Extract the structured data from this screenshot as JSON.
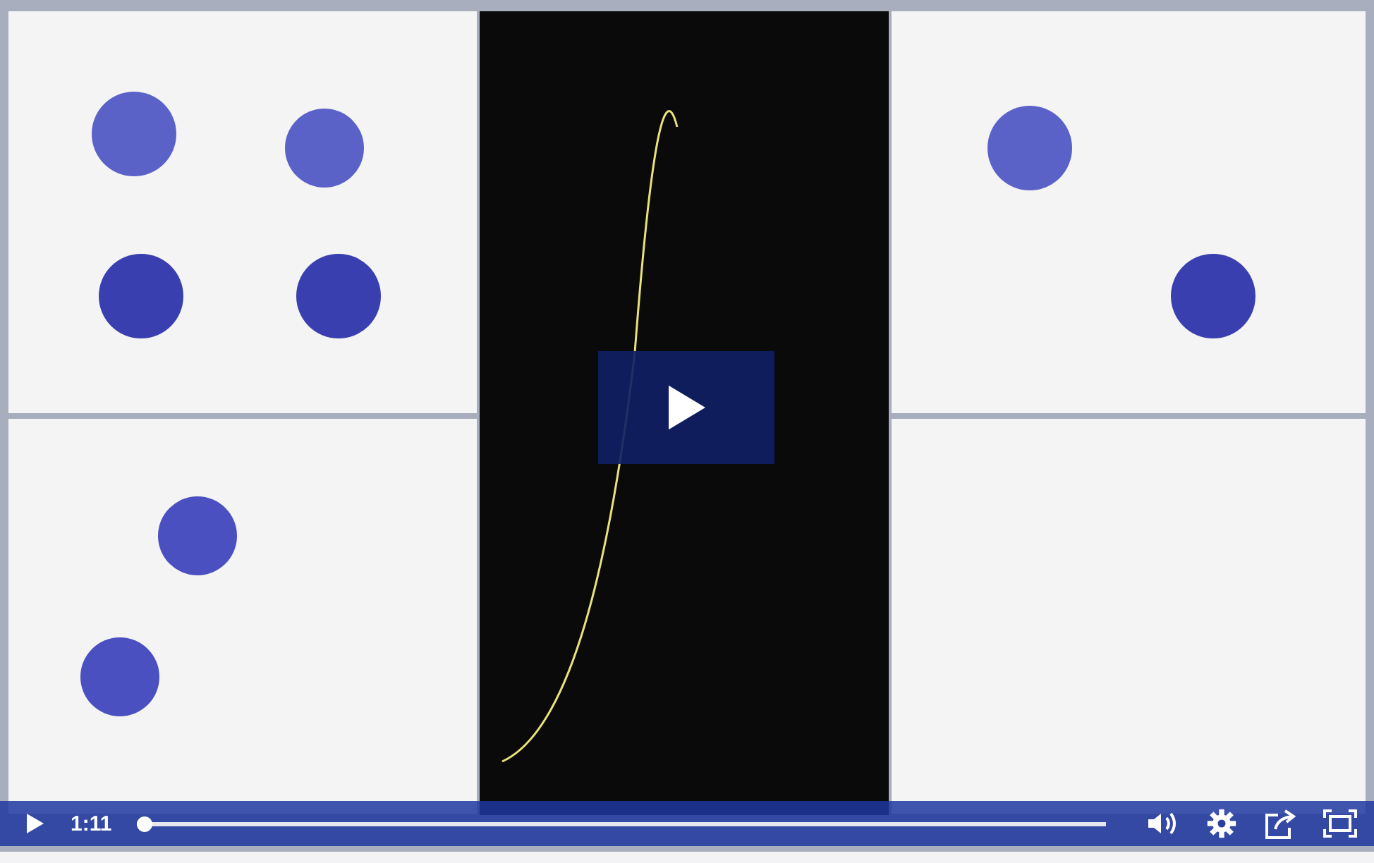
{
  "player": {
    "paused": true,
    "time": "1:11",
    "progress": {
      "level": 0.0
    }
  }
}
